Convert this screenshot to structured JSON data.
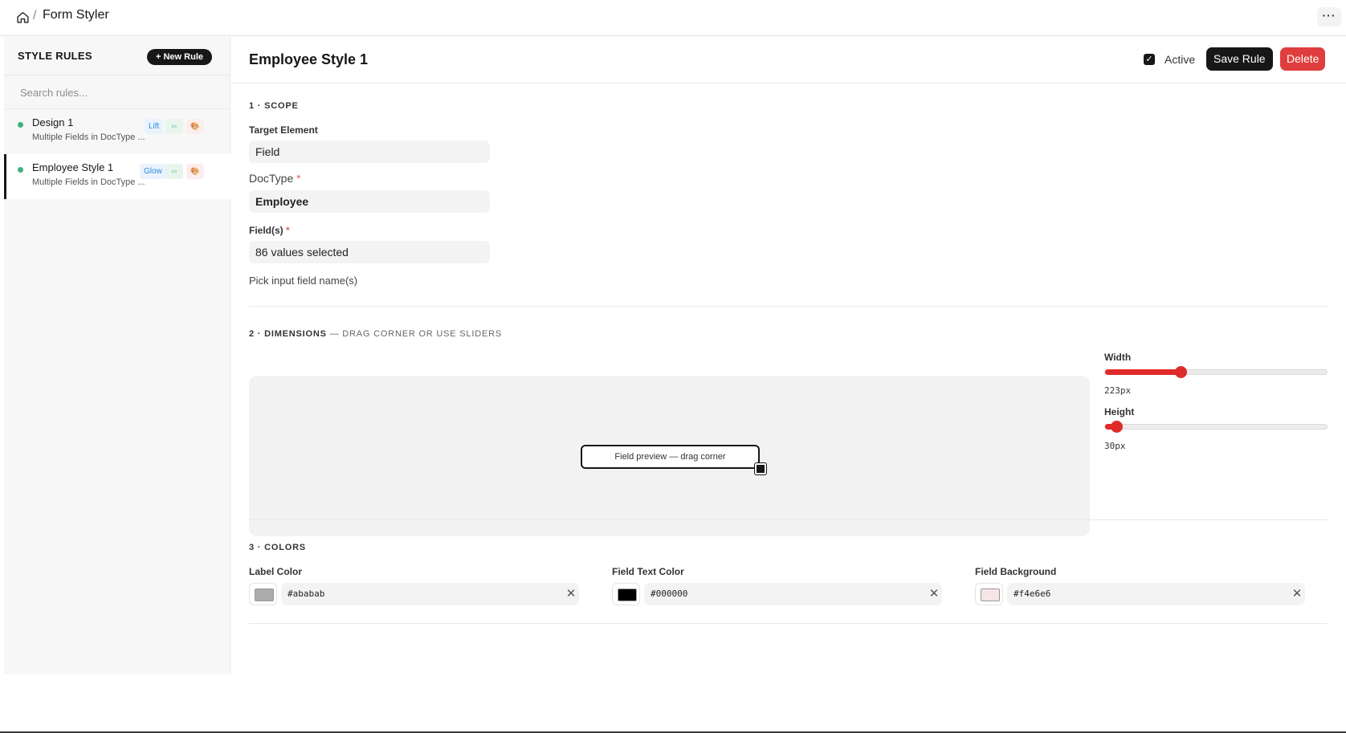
{
  "breadcrumb": {
    "title": "Form Styler",
    "separator": "/"
  },
  "topbar": {
    "more_label": "···"
  },
  "sidebar": {
    "title": "STYLE RULES",
    "new_rule_label": "+ New Rule",
    "search_placeholder": "Search rules...",
    "items": [
      {
        "name": "Design 1",
        "subtitle": "Multiple Fields in DocType ...",
        "effect": "Lift",
        "dim_icon": "⇔",
        "color_icon": "🎨",
        "active": false
      },
      {
        "name": "Employee Style 1",
        "subtitle": "Multiple Fields in DocType ...",
        "effect": "Glow",
        "dim_icon": "⇔",
        "color_icon": "🎨",
        "active": true
      }
    ]
  },
  "main": {
    "title": "Employee Style 1",
    "active_label": "Active",
    "active_checked": true,
    "save_label": "Save Rule",
    "delete_label": "Delete"
  },
  "scope": {
    "heading": "1 · SCOPE",
    "target_label": "Target Element",
    "target_value": "Field",
    "doctype_label": "DocType",
    "doctype_value": "Employee",
    "fields_label": "Field(s)",
    "fields_value": "86 values selected",
    "fields_help": "Pick input field name(s)",
    "required_mark": "*"
  },
  "dimensions": {
    "heading": "2 · DIMENSIONS",
    "heading_note": " — DRAG CORNER OR USE SLIDERS",
    "preview_text": "Field preview — drag corner",
    "width_label": "Width",
    "width_value": "223px",
    "width_fraction": 0.34,
    "height_label": "Height",
    "height_value": "30px",
    "height_fraction": 0.05
  },
  "colors": {
    "heading": "3 · COLORS",
    "label_color_label": "Label Color",
    "label_color_value": "#ababab",
    "text_color_label": "Field Text Color",
    "text_color_value": "#000000",
    "bg_color_label": "Field Background",
    "bg_color_value": "#f4e6e6",
    "clear_label": "✕"
  },
  "theme": {
    "accent": "#e02a2a",
    "primary": "#171717",
    "danger": "#e03e3e",
    "status_dot": "#3fb27f"
  }
}
